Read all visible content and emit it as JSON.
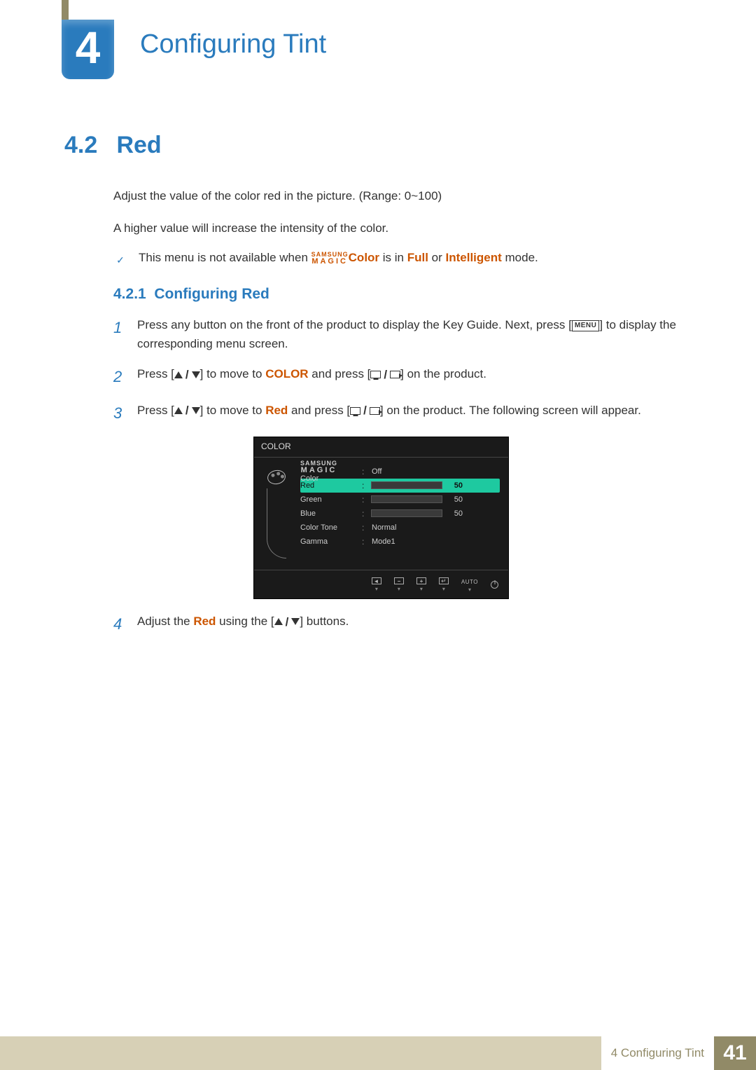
{
  "chapter": {
    "number": "4",
    "title": "Configuring Tint"
  },
  "section": {
    "number": "4.2",
    "title": "Red"
  },
  "intro": {
    "p1": "Adjust the value of the color red in the picture. (Range: 0~100)",
    "p2": "A higher value will increase the intensity of the color."
  },
  "note": {
    "pre": "This menu is not available when ",
    "magic_top": "SAMSUNG",
    "magic_bottom": "MAGIC",
    "color": "Color",
    "mid1": " is in ",
    "full": "Full",
    "mid2": " or ",
    "intelligent": "Intelligent",
    "post": " mode."
  },
  "subsection": {
    "number": "4.2.1",
    "title": "Configuring Red"
  },
  "steps": {
    "s1": {
      "pre": "Press any button on the front of the product to display the Key Guide. Next, press [",
      "menu": "MENU",
      "post": "] to display the corresponding menu screen."
    },
    "s2": {
      "pre": "Press [",
      "mid": "] to move to ",
      "color": "COLOR",
      "mid2": " and press [",
      "post": "] on the product."
    },
    "s3": {
      "pre": "Press [",
      "mid": "] to move to ",
      "red": "Red",
      "mid2": " and press [",
      "post": "] on the product. The following screen will appear."
    },
    "s4": {
      "pre": "Adjust the ",
      "red": "Red",
      "mid": " using the [",
      "post": "] buttons."
    }
  },
  "osd": {
    "title": "COLOR",
    "magic_top": "SAMSUNG",
    "magic_bottom": "MAGIC",
    "magic_suffix": " Color",
    "rows": {
      "magic_val": "Off",
      "red": {
        "label": "Red",
        "value": 50,
        "max": 100
      },
      "green": {
        "label": "Green",
        "value": 50,
        "max": 100
      },
      "blue": {
        "label": "Blue",
        "value": 50,
        "max": 100
      },
      "tone": {
        "label": "Color Tone",
        "value": "Normal"
      },
      "gamma": {
        "label": "Gamma",
        "value": "Mode1"
      }
    },
    "footer_auto": "AUTO"
  },
  "footer": {
    "label": "4 Configuring Tint",
    "page": "41"
  }
}
